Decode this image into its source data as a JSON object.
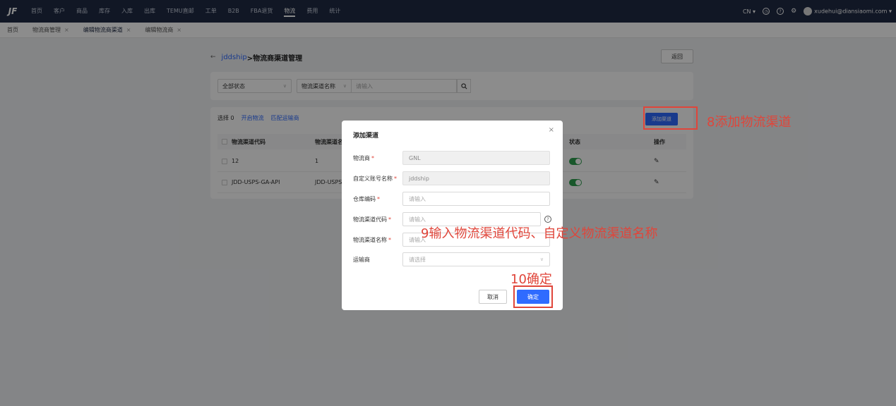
{
  "topbar": {
    "logo": "JF",
    "nav": [
      "首页",
      "客户",
      "商品",
      "库存",
      "入库",
      "出库",
      "TEMU直邮",
      "工单",
      "B2B",
      "FBA退货",
      "物流",
      "费用",
      "统计"
    ],
    "active_nav": "物流",
    "lang": "CN ▾",
    "user": "xudehui@diansiaomi.com ▾"
  },
  "tabs": [
    {
      "label": "首页",
      "closable": false
    },
    {
      "label": "物流商管理",
      "closable": true
    },
    {
      "label": "编辑物流商渠道",
      "closable": true,
      "active": true
    },
    {
      "label": "编辑物流商",
      "closable": true
    }
  ],
  "page": {
    "back_arrow": "←",
    "crumb_link": "jddship",
    "crumb_title": ">物流商渠道管理",
    "back_button": "返回"
  },
  "filters": {
    "status": "全部状态",
    "field": "物流渠道名称",
    "search_placeholder": "请输入"
  },
  "table": {
    "selected_label": "选择 0",
    "link_enable": "开启物流",
    "link_match": "匹配运输商",
    "add_button": "添加渠道",
    "headers": [
      "物流渠道代码",
      "物流渠道名",
      "状态",
      "操作"
    ],
    "rows": [
      {
        "code": "12",
        "name": "1"
      },
      {
        "code": "JDD-USPS-GA-API",
        "name": "JDD-USPS-"
      }
    ]
  },
  "modal": {
    "title": "添加渠道",
    "close": "×",
    "fields": [
      {
        "label": "物流商",
        "required": true,
        "value": "GNL",
        "disabled": true
      },
      {
        "label": "自定义账号名称",
        "required": true,
        "value": "jddship",
        "disabled": true
      },
      {
        "label": "仓库编码",
        "required": true,
        "placeholder": "请输入"
      },
      {
        "label": "物流渠道代码",
        "required": true,
        "placeholder": "请输入",
        "help": true
      },
      {
        "label": "物流渠道名称",
        "required": true,
        "placeholder": "请输入"
      },
      {
        "label": "运输商",
        "required": false,
        "placeholder": "请选择",
        "select": true
      }
    ],
    "cancel": "取消",
    "confirm": "确定"
  },
  "annotations": {
    "step8": "8添加物流渠道",
    "step9": "9输入物流渠道代码、自定义物流渠道名称",
    "step10": "10确定",
    "color": "#e0453a"
  }
}
